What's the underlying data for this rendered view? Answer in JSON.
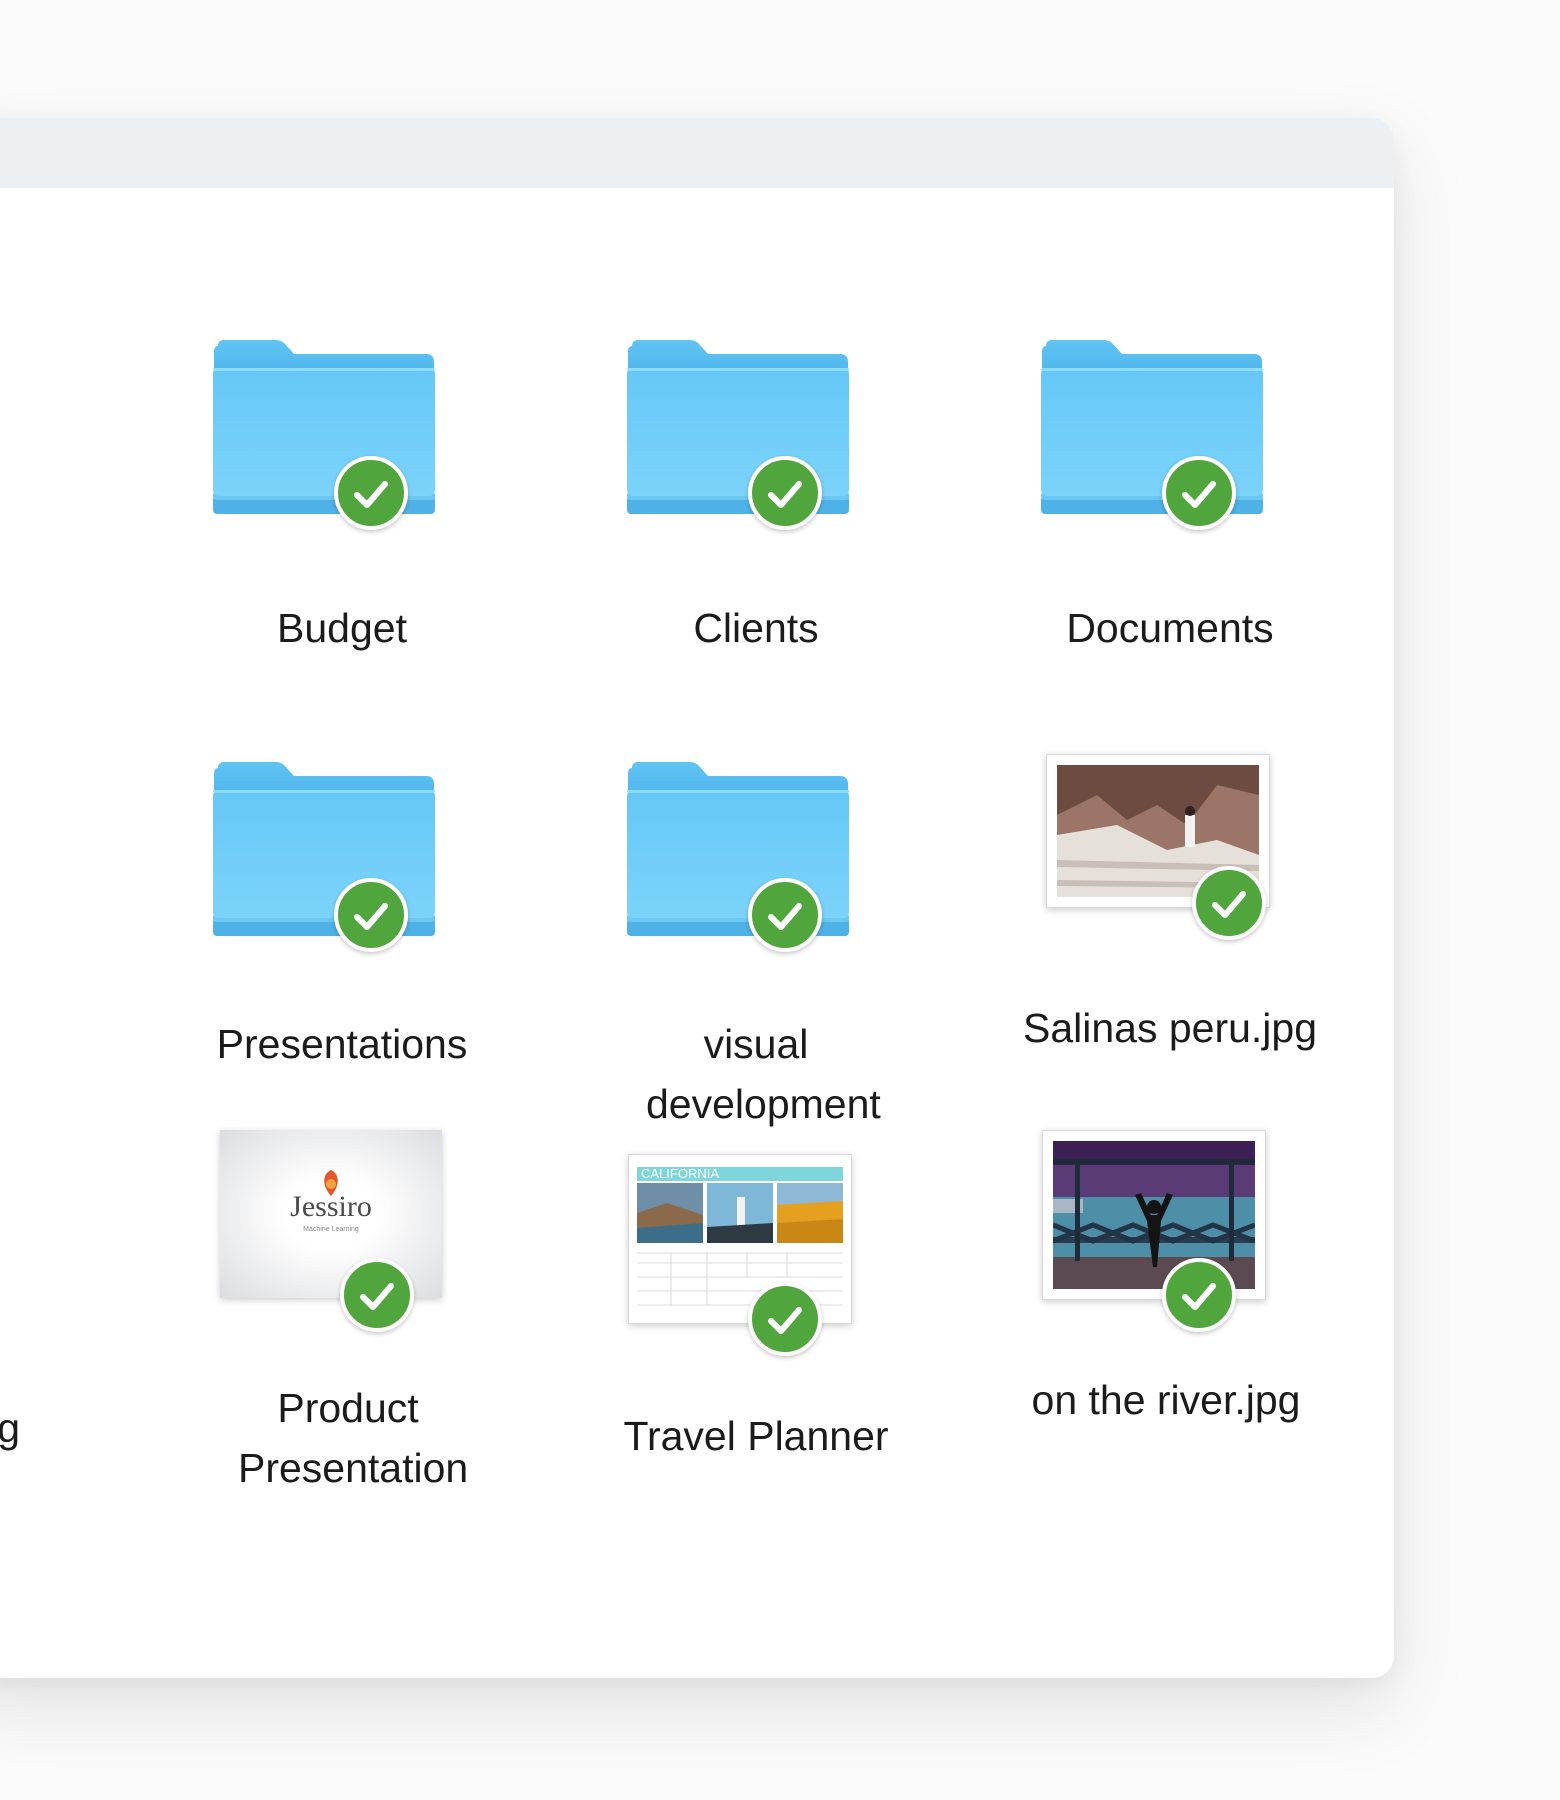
{
  "finder": {
    "items": [
      {
        "label": "g"
      },
      {
        "label": "Budget"
      },
      {
        "label": "Clients"
      },
      {
        "label": "Documents"
      },
      {
        "label": "Presentations"
      },
      {
        "label": "visual development"
      },
      {
        "label": "Salinas peru.jpg"
      },
      {
        "label": ".jpg"
      },
      {
        "label": "Product Presentation"
      },
      {
        "label": "Travel Planner"
      },
      {
        "label": "on the river.jpg"
      }
    ],
    "thumbnails": {
      "product_logo": "Jessiro",
      "product_tagline": "Machine Learning",
      "planner_title": "CALIFORNIA"
    }
  },
  "colors": {
    "folder_blue": "#6fcdf7",
    "sync_green": "#50a63c",
    "titlebar": "#edf0f2"
  }
}
